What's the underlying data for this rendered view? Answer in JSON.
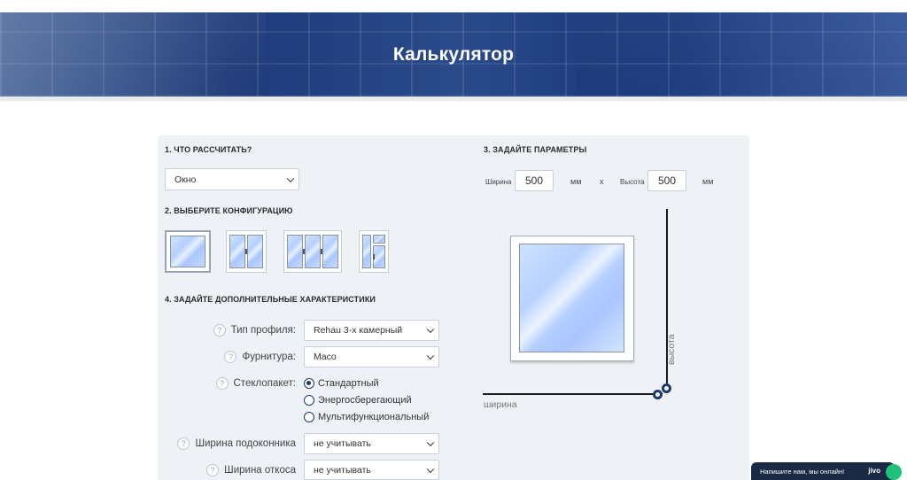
{
  "hero": {
    "title": "Калькулятор"
  },
  "section1": {
    "title": "1. Что рассчитать?",
    "select_value": "Окно"
  },
  "section2": {
    "title": "2. Выберите конфигурацию",
    "configs": [
      "single",
      "double",
      "triple",
      "door"
    ]
  },
  "section3": {
    "title": "3. Задайте параметры",
    "width_label": "Ширина",
    "width_value": "500",
    "width_unit": "мм",
    "times": "х",
    "height_label": "Высота",
    "height_value": "500",
    "height_unit": "мм"
  },
  "section4": {
    "title": "4. Задайте дополнительные характеристики",
    "profile_label": "Тип профиля:",
    "profile_value": "Rehau 3-х камерный",
    "fittings_label": "Фурнитура:",
    "fittings_value": "Maco",
    "glass_label": "Стеклопакет:",
    "glass_options": [
      "Стандартный",
      "Энергосберегающий",
      "Мультифункциональный"
    ],
    "glass_selected": 0,
    "sill_label": "Ширина подоконника",
    "sill_value": "не учитывать",
    "slope_label": "Ширина откоса",
    "slope_value": "не учитывать"
  },
  "diagram": {
    "height_text": "высота",
    "width_text": "ширина"
  },
  "chat": {
    "text": "Напишите нам, мы онлайн!",
    "brand": "jivo"
  },
  "colors": {
    "accent": "#1b3a6b",
    "panel": "#eef2f6",
    "hero": "#1d3a7a"
  }
}
